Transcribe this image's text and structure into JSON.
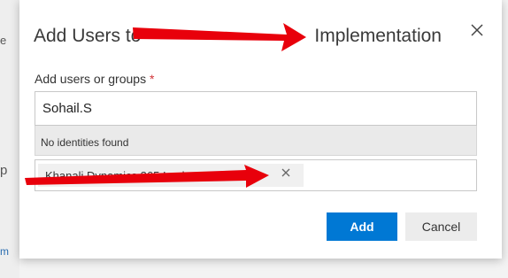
{
  "background": {
    "fragment_top": "e",
    "fragment_mid": "p",
    "fragment_bottom": "m"
  },
  "dialog": {
    "title_prefix": "Add Users to",
    "title_suffix": "Implementation",
    "close_icon": "close-icon"
  },
  "form": {
    "label": "Add users or groups",
    "required_marker": "*",
    "input_value": "Sohail.S",
    "no_results": "No identities found",
    "selected_chip": "Khanali Dynamics 365 Implementation"
  },
  "buttons": {
    "add": "Add",
    "cancel": "Cancel"
  },
  "colors": {
    "primary": "#0078d4",
    "annotation_arrow": "#e8000b"
  }
}
